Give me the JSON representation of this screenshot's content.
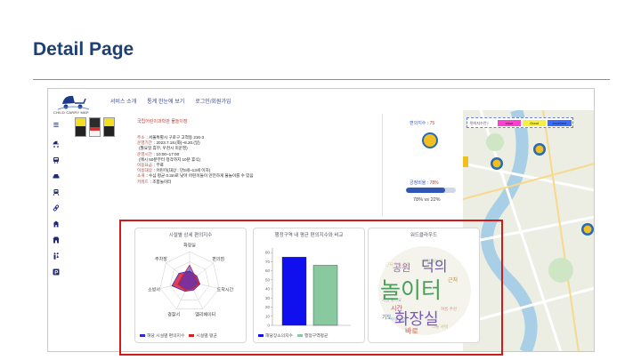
{
  "slide_title": "Detail Page",
  "logo_text": "CHILD CARRY MAP",
  "nav": [
    "서비스 소개",
    "통계 한눈에 보기",
    "로그인/회원가입"
  ],
  "sidebar_icons": [
    "hamburger-icon",
    "stroller-icon",
    "bus-icon",
    "car-icon",
    "train-icon",
    "link-icon",
    "building-icon",
    "store-icon",
    "restroom-icon",
    "parking-icon"
  ],
  "info": {
    "place_name": "국립어린이과학관 물놀이장",
    "lines": [
      {
        "key": "주소",
        "value": ": 서울특별시 구로구 고척동 216-3"
      },
      {
        "key": "운영기간",
        "value": ": 2023.7.18.(화)~8.20.(일)"
      },
      {
        "key": "",
        "value": "(월요일 휴무, 우천시 미운영)"
      },
      {
        "key": "운영시간",
        "value": ": 10:00~17:00"
      },
      {
        "key": "",
        "value": "(매시 50분부터 정각까지 10분 휴식)"
      },
      {
        "key": "이용요금",
        "value": ": 무료"
      },
      {
        "key": "이용대상",
        "value": ": 어린이(대상 : 만3세~13세 이하)"
      },
      {
        "key": "소개",
        "value": ": 수심 평균 0.3m로 낮아 어린이들이 안전하게 물놀이를 수 있음"
      },
      {
        "key": "키워드",
        "value": ": 조합놀이터"
      }
    ]
  },
  "score": {
    "label": "편의지수 : ",
    "value": "75"
  },
  "ratio": {
    "label": "긍정비율 : ",
    "value": "78%",
    "fraction": 0.78,
    "compare": "78% vs 22%"
  },
  "map_legend": {
    "label": "편의지수란?",
    "items": [
      "soso",
      "Good",
      "excellent"
    ],
    "colors": [
      "#ff3fd0",
      "#f7f03a",
      "#3b6bff"
    ]
  },
  "radar_card": {
    "title": "시설별 상세 편의지수",
    "axes": [
      "화장실",
      "편의점",
      "도착시간",
      "엘리베이터",
      "경찰서",
      "소방서",
      "주차장"
    ],
    "legend": [
      "해당 시설별 편의지수",
      "시설별 평균"
    ],
    "legend_colors": [
      "#2a2ad0",
      "#d42020"
    ]
  },
  "bar_card": {
    "title": "행정구역 내 평균 편의지수와 비교",
    "legend": [
      "해당장소의지수",
      "행정구역평균"
    ],
    "colors": [
      "#1010ee",
      "#88c9a0"
    ]
  },
  "cloud_card": {
    "title": "워드클라우드",
    "words": [
      "놀이터",
      "화장실",
      "덕의",
      "공원",
      "시간",
      "바로",
      "근처",
      "기도"
    ]
  },
  "chart_data": [
    {
      "type": "bar",
      "title": "행정구역 내 평균 편의지수와 비교",
      "categories": [
        "해당장소의지수",
        "행정구역평균"
      ],
      "values": [
        75,
        66
      ],
      "yticks": [
        0,
        10,
        20,
        30,
        40,
        50,
        60,
        70,
        80
      ],
      "ylim": [
        0,
        85
      ],
      "grid": false
    },
    {
      "type": "radar",
      "title": "시설별 상세 편의지수",
      "categories": [
        "화장실",
        "편의점",
        "도착시간",
        "엘리베이터",
        "경찰서",
        "소방서",
        "주차장"
      ],
      "series": [
        {
          "name": "해당 시설별 편의지수",
          "values": [
            0.35,
            0.3,
            0.35,
            0.3,
            0.35,
            0.6,
            0.45
          ]
        },
        {
          "name": "시설별 평균",
          "values": [
            0.55,
            0.25,
            0.3,
            0.25,
            0.3,
            0.4,
            0.3
          ]
        }
      ]
    }
  ]
}
